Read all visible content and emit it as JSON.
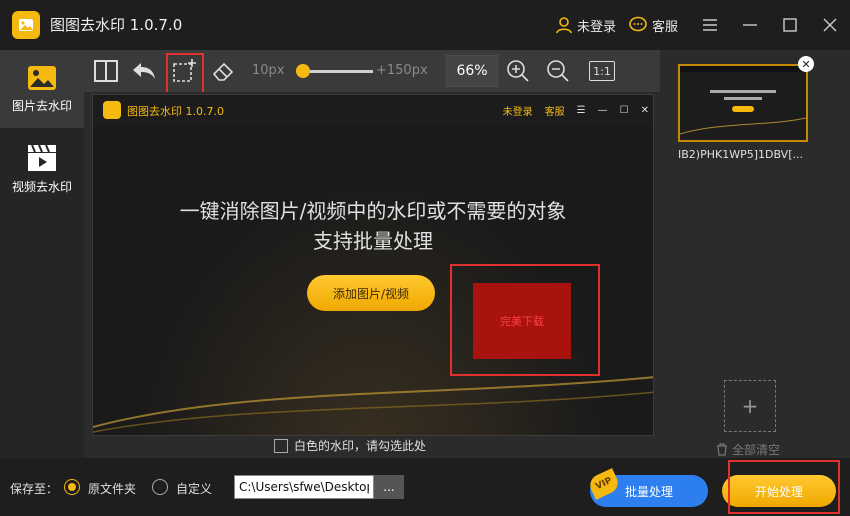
{
  "app": {
    "title": "图图去水印  1.0.7.0",
    "login": "未登录",
    "support": "客服"
  },
  "sidebar": {
    "items": [
      {
        "label": "图片去水印"
      },
      {
        "label": "视频去水印"
      }
    ]
  },
  "toolbar": {
    "brush_min": "10px",
    "brush_max": "+150px",
    "brush_level": 0.07,
    "zoom": "66%",
    "zoom_reset": "1:1"
  },
  "preview": {
    "title": "图图去水印  1.0.7.0",
    "login": "未登录",
    "support": "客服",
    "headline1": "一键消除图片/视频中的水印或不需要的对象",
    "headline2": "支持批量处理",
    "add_button": "添加图片/视频",
    "red_box_text": "完美下载"
  },
  "white_watermark": {
    "label": "白色的水印，请勾选此处"
  },
  "queue": {
    "file_name": "IB2)PHK1WP5]1DBV[...",
    "clear_all": "全部清空",
    "add_symbol": "+"
  },
  "bottom": {
    "save_to": "保存至：",
    "opt_original": "原文件夹",
    "opt_custom": "自定义",
    "path": "C:\\Users\\sfwe\\Desktop",
    "browse": "...",
    "vip": "VIP",
    "batch": "批量处理",
    "start": "开始处理"
  },
  "colors": {
    "accent": "#f5b90f",
    "highlight_red": "#e03030",
    "batch_blue": "#2d7ff0"
  }
}
